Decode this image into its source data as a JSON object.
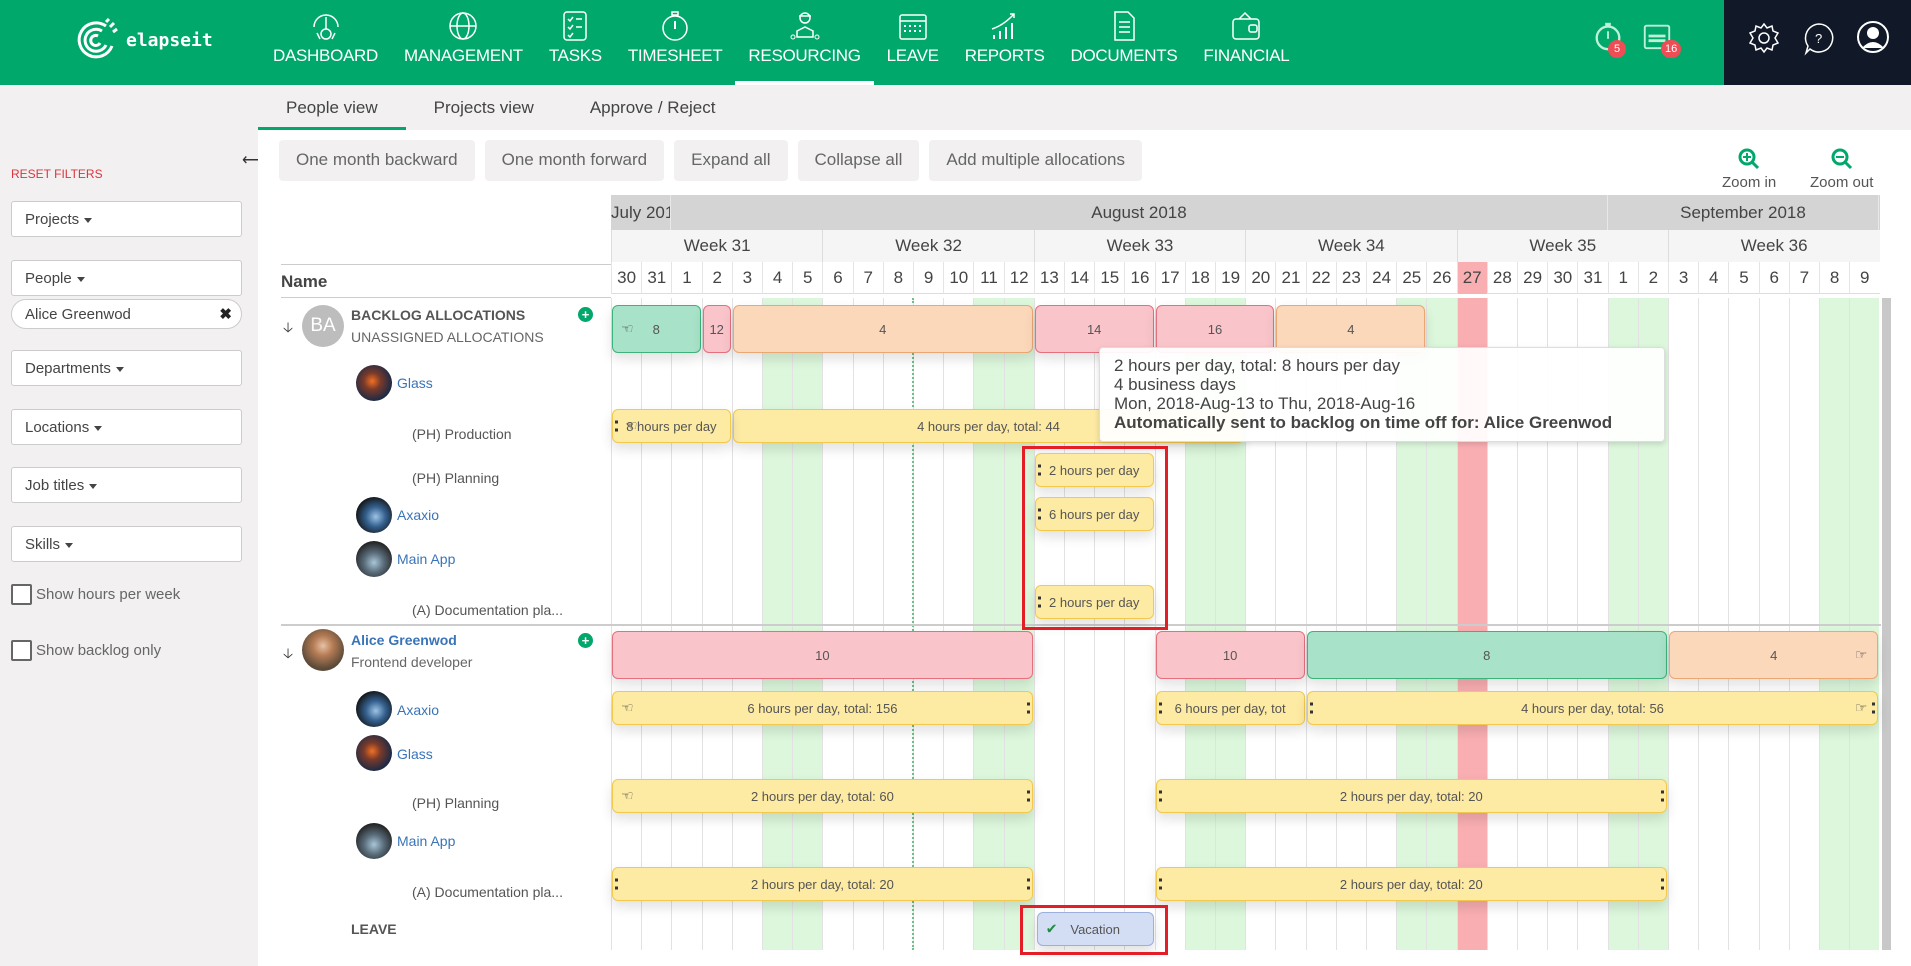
{
  "app": {
    "name": "elapseit"
  },
  "nav": {
    "items": [
      {
        "label": "DASHBOARD",
        "icon": "dashboard-gauge-icon"
      },
      {
        "label": "MANAGEMENT",
        "icon": "globe-icon"
      },
      {
        "label": "TASKS",
        "icon": "checklist-icon"
      },
      {
        "label": "TIMESHEET",
        "icon": "stopwatch-icon"
      },
      {
        "label": "RESOURCING",
        "icon": "worker-icon",
        "active": true
      },
      {
        "label": "LEAVE",
        "icon": "calendar-icon"
      },
      {
        "label": "REPORTS",
        "icon": "chart-icon"
      },
      {
        "label": "DOCUMENTS",
        "icon": "document-icon"
      },
      {
        "label": "FINANCIAL",
        "icon": "wallet-icon"
      }
    ],
    "timer_badge": "5",
    "calendar_badge": "16"
  },
  "sidebar": {
    "reset_filters": "RESET FILTERS",
    "filters": {
      "projects": "Projects",
      "people": "People",
      "people_selected": "Alice Greenwod",
      "departments": "Departments",
      "locations": "Locations",
      "job_titles": "Job titles",
      "skills": "Skills"
    },
    "show_hours_per_week": "Show hours per week",
    "show_backlog_only": "Show backlog only"
  },
  "tabs": [
    {
      "label": "People view",
      "active": true
    },
    {
      "label": "Projects view"
    },
    {
      "label": "Approve / Reject"
    }
  ],
  "toolbar": {
    "month_backward": "One month backward",
    "month_forward": "One month forward",
    "expand_all": "Expand all",
    "collapse_all": "Collapse all",
    "add_multiple": "Add multiple allocations",
    "zoom_in": "Zoom in",
    "zoom_out": "Zoom out"
  },
  "timeline": {
    "name_header": "Name",
    "months": [
      {
        "label": "July 201",
        "days": 2
      },
      {
        "label": "August 2018",
        "days": 31
      },
      {
        "label": "September 2018",
        "days": 9
      }
    ],
    "weeks": [
      {
        "label": "Week 31",
        "start": 0,
        "days": 7
      },
      {
        "label": "Week 32",
        "start": 7,
        "days": 7
      },
      {
        "label": "Week 33",
        "start": 14,
        "days": 7
      },
      {
        "label": "Week 34",
        "start": 21,
        "days": 7
      },
      {
        "label": "Week 35",
        "start": 28,
        "days": 7
      },
      {
        "label": "Week 36",
        "start": 35,
        "days": 7
      }
    ],
    "days": [
      "30",
      "31",
      "1",
      "2",
      "3",
      "4",
      "5",
      "6",
      "7",
      "8",
      "9",
      "10",
      "11",
      "12",
      "13",
      "14",
      "15",
      "16",
      "17",
      "18",
      "19",
      "20",
      "21",
      "22",
      "23",
      "24",
      "25",
      "26",
      "27",
      "28",
      "29",
      "30",
      "31",
      "1",
      "2",
      "3",
      "4",
      "5",
      "6",
      "7",
      "8",
      "9"
    ],
    "weekend_indexes": [
      5,
      6,
      12,
      13,
      19,
      20,
      26,
      27,
      33,
      34,
      40,
      41
    ],
    "holiday_indexes": [
      28
    ],
    "today_index": 10
  },
  "backlog": {
    "initials": "BA",
    "title": "BACKLOG ALLOCATIONS",
    "subtitle": "UNASSIGNED ALLOCATIONS",
    "projects": [
      {
        "name": "Glass"
      },
      {
        "name": "(PH) Production",
        "task": true
      },
      {
        "name": "(PH) Planning",
        "task": true
      },
      {
        "name": "Axaxio"
      },
      {
        "name": "Main App"
      },
      {
        "name": "(A) Documentation pla...",
        "task": true
      }
    ],
    "summary_bars": [
      {
        "start": 0,
        "end": 3,
        "label": "8",
        "color": "green",
        "hand": true
      },
      {
        "start": 3,
        "end": 4,
        "label": "12",
        "color": "pink"
      },
      {
        "start": 4,
        "end": 14,
        "label": "4",
        "color": "orange"
      },
      {
        "start": 14,
        "end": 18,
        "label": "14",
        "color": "pink"
      },
      {
        "start": 18,
        "end": 22,
        "label": "16",
        "color": "pink"
      },
      {
        "start": 22,
        "end": 27,
        "label": "4",
        "color": "orange"
      }
    ],
    "allocation_bars": [
      {
        "row": 1,
        "start": 4,
        "end": 21,
        "label": "4 hours per day, total: 44",
        "color": "yellow"
      },
      {
        "row": 1,
        "start": 0,
        "end": 4,
        "label": "8 hours per day",
        "color": "yellow",
        "hand": true,
        "lh": true
      },
      {
        "row": 2,
        "start": 14,
        "end": 18,
        "label": "2 hours per day",
        "color": "yellow",
        "lh": true
      },
      {
        "row": 3,
        "start": 14,
        "end": 18,
        "label": "6 hours per day",
        "color": "yellow",
        "lh": true
      },
      {
        "row": 5,
        "start": 14,
        "end": 18,
        "label": "2 hours per day",
        "color": "yellow",
        "lh": true
      }
    ]
  },
  "tooltip": {
    "line1": "2 hours per day, total: 8 hours per day",
    "line2": "4 business days",
    "line3": "Mon, 2018-Aug-13 to Thu, 2018-Aug-16",
    "line4": "Automatically sent to backlog on time off for: Alice Greenwod"
  },
  "person": {
    "name": "Alice Greenwod",
    "role": "Frontend developer",
    "projects": [
      {
        "name": "Axaxio"
      },
      {
        "name": "Glass"
      },
      {
        "name": "(PH) Planning",
        "task": true
      },
      {
        "name": "Main App"
      },
      {
        "name": "(A) Documentation pla...",
        "task": true
      }
    ],
    "leave_label": "LEAVE",
    "summary_bars": [
      {
        "start": 0,
        "end": 14,
        "label": "10",
        "color": "pink"
      },
      {
        "start": 18,
        "end": 23,
        "label": "10",
        "color": "pink"
      },
      {
        "start": 23,
        "end": 35,
        "label": "8",
        "color": "green"
      },
      {
        "start": 35,
        "end": 42,
        "label": "4",
        "color": "orange",
        "hand_right": true
      }
    ],
    "allocation_bars": [
      {
        "row": 0,
        "start": 0,
        "end": 14,
        "label": "6 hours per day, total: 156",
        "color": "yellow",
        "hand": true,
        "rh": true
      },
      {
        "row": 0,
        "start": 18,
        "end": 23,
        "label": "6 hours per day, tot",
        "color": "yellow",
        "lh": true
      },
      {
        "row": 0,
        "start": 23,
        "end": 42,
        "label": "4 hours per day, total: 56",
        "color": "yellow",
        "lh": true,
        "rh": true,
        "hand_right": true
      },
      {
        "row": 2,
        "start": 0,
        "end": 14,
        "label": "2 hours per day, total: 60",
        "color": "yellow",
        "hand": true,
        "rh": true
      },
      {
        "row": 2,
        "start": 18,
        "end": 35,
        "label": "2 hours per day, total: 20",
        "color": "yellow",
        "lh": true,
        "rh": true
      },
      {
        "row": 4,
        "start": 0,
        "end": 14,
        "label": "2 hours per day, total: 20",
        "color": "yellow",
        "lh": true,
        "rh": true
      },
      {
        "row": 4,
        "start": 18,
        "end": 35,
        "label": "2 hours per day, total: 20",
        "color": "yellow",
        "lh": true,
        "rh": true
      }
    ],
    "leave_bar": {
      "start": 14,
      "end": 18,
      "label": "Vacation",
      "status": "approved"
    }
  },
  "colors": {
    "brand": "#00a86b",
    "dark": "#111827",
    "reset": "#d9363e",
    "highlight": "#e41e26",
    "weekend": "#dcf7dc",
    "holiday": "#f9aeb1"
  }
}
